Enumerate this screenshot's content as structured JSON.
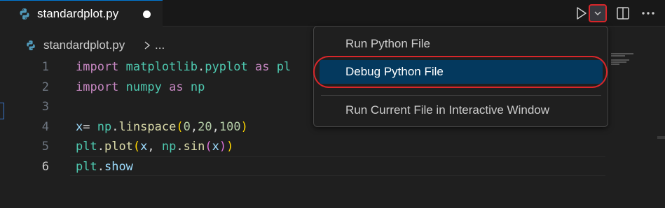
{
  "tab": {
    "filename": "standardplot.py"
  },
  "breadcrumb": {
    "file": "standardplot.py",
    "more": "..."
  },
  "editor": {
    "lines": [
      {
        "number": "1",
        "tokens": [
          [
            "kw",
            "import"
          ],
          [
            "punc",
            " "
          ],
          [
            "mod",
            "matplotlib"
          ],
          [
            "punc",
            "."
          ],
          [
            "mod",
            "pyplot"
          ],
          [
            "punc",
            " "
          ],
          [
            "kw",
            "as"
          ],
          [
            "punc",
            " "
          ],
          [
            "mod",
            "pl"
          ]
        ]
      },
      {
        "number": "2",
        "tokens": [
          [
            "kw",
            "import"
          ],
          [
            "punc",
            " "
          ],
          [
            "mod",
            "numpy"
          ],
          [
            "punc",
            " "
          ],
          [
            "kw",
            "as"
          ],
          [
            "punc",
            " "
          ],
          [
            "mod",
            "np"
          ]
        ]
      },
      {
        "number": "3",
        "tokens": []
      },
      {
        "number": "4",
        "tokens": [
          [
            "var",
            "x"
          ],
          [
            "punc",
            "= "
          ],
          [
            "mod",
            "np"
          ],
          [
            "punc",
            "."
          ],
          [
            "fn",
            "linspace"
          ],
          [
            "p1",
            "("
          ],
          [
            "num",
            "0"
          ],
          [
            "punc",
            ","
          ],
          [
            "num",
            "20"
          ],
          [
            "punc",
            ","
          ],
          [
            "num",
            "100"
          ],
          [
            "p1",
            ")"
          ]
        ]
      },
      {
        "number": "5",
        "tokens": [
          [
            "mod",
            "plt"
          ],
          [
            "punc",
            "."
          ],
          [
            "fn",
            "plot"
          ],
          [
            "p1",
            "("
          ],
          [
            "var",
            "x"
          ],
          [
            "punc",
            ", "
          ],
          [
            "mod",
            "np"
          ],
          [
            "punc",
            "."
          ],
          [
            "fn",
            "sin"
          ],
          [
            "p2",
            "("
          ],
          [
            "var",
            "x"
          ],
          [
            "p2",
            ")"
          ],
          [
            "p1",
            ")"
          ]
        ]
      },
      {
        "number": "6",
        "tokens": [
          [
            "mod",
            "plt"
          ],
          [
            "punc",
            "."
          ],
          [
            "var",
            "show"
          ]
        ]
      }
    ],
    "active_line": "6"
  },
  "menu": {
    "items": [
      {
        "label": "Run Python File"
      },
      {
        "label": "Debug Python File",
        "selected": true
      },
      {
        "label": "Run Current File in Interactive Window"
      }
    ]
  },
  "icons": {
    "tab_file": "python-icon",
    "run": "play-icon",
    "run_dropdown": "chevron-down-icon",
    "split": "split-editor-icon",
    "more": "more-actions-icon"
  },
  "colors": {
    "accent": "#0078d4",
    "annotation": "#d9262a",
    "selection": "#04395e"
  }
}
